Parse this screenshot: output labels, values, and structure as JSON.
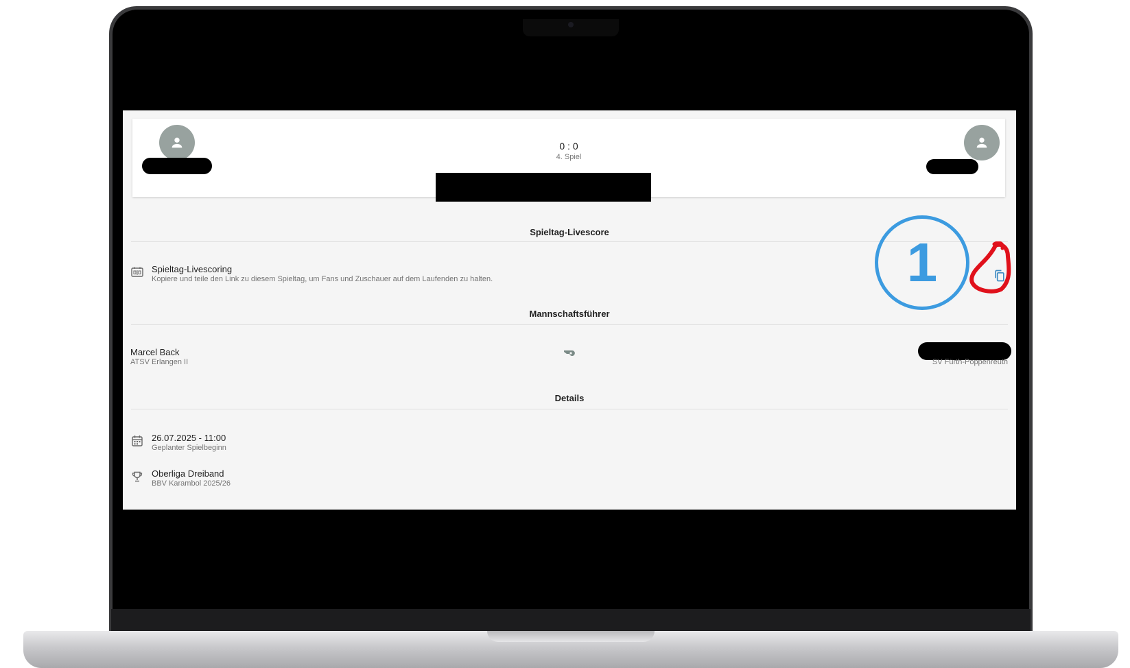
{
  "scoreboard": {
    "score": "0 : 0",
    "game_label": "4. Spiel"
  },
  "livescore_section": {
    "title": "Spieltag-Livescore",
    "item_title": "Spieltag-Livescoring",
    "item_description": "Kopiere und teile den Link zu diesem Spieltag, um Fans und Zuschauer auf dem Laufenden zu halten.",
    "item_icon": "scoreboard-icon",
    "action_icon": "copy-icon"
  },
  "captains_section": {
    "title": "Mannschaftsführer",
    "home": {
      "name": "Marcel Back",
      "team": "ATSV Erlangen II"
    },
    "away": {
      "team": "SV Fürth-Poppenreuth"
    },
    "center_icon": "whistle-icon"
  },
  "details_section": {
    "title": "Details",
    "items": [
      {
        "icon": "calendar-icon",
        "primary": "26.07.2025 - 11:00",
        "secondary": "Geplanter Spielbeginn"
      },
      {
        "icon": "trophy-icon",
        "primary": "Oberliga Dreiband",
        "secondary": "BBV Karambol 2025/26"
      }
    ]
  },
  "annotations": {
    "step_number": "1",
    "marker_color": "#3c9be0",
    "highlight_color": "#e0111b"
  },
  "colors": {
    "avatar_bg": "#98a29f",
    "icon_accent": "#3f8cc4"
  }
}
